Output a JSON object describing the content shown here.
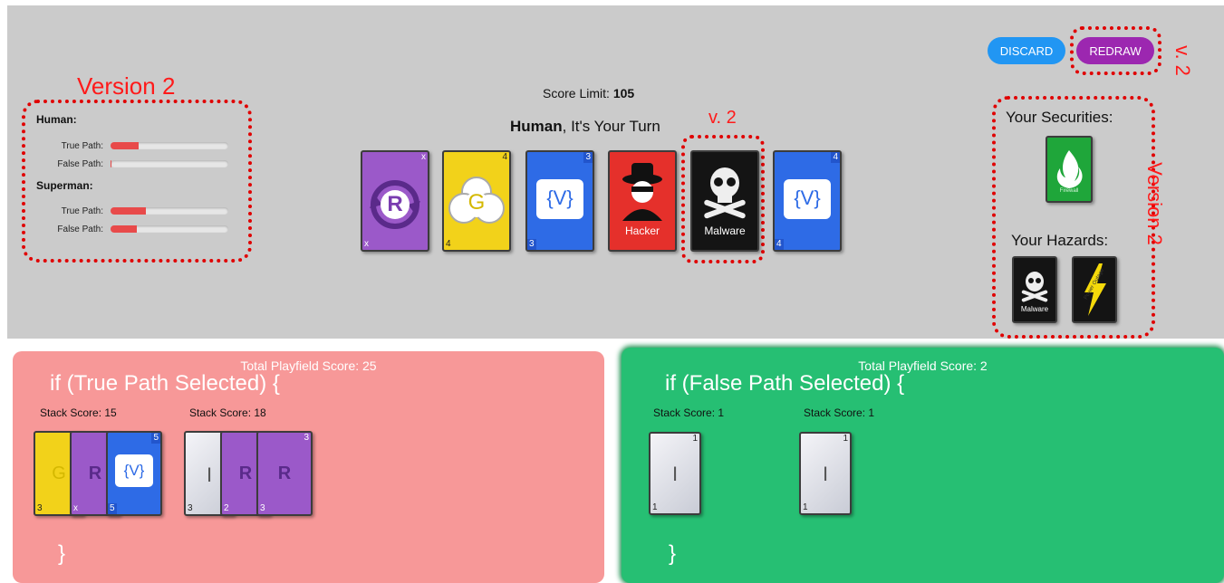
{
  "annotations": {
    "version2_players": "Version 2",
    "v2_redraw": "v. 2",
    "v2_malware": "v. 2",
    "version2_side": "Version 2"
  },
  "header": {
    "score_limit_label": "Score Limit:",
    "score_limit_value": "105",
    "turn_name": "Human",
    "turn_text": ", It's Your Turn"
  },
  "buttons": {
    "discard": "DISCARD",
    "redraw": "REDRAW"
  },
  "players": [
    {
      "name": "Human:",
      "true_label": "True Path:",
      "false_label": "False Path:",
      "true_pct": 24,
      "false_pct": 1
    },
    {
      "name": "Superman:",
      "true_label": "True Path:",
      "false_label": "False Path:",
      "true_pct": 30,
      "false_pct": 22
    }
  ],
  "hand": [
    {
      "type": "rotate",
      "color": "purple",
      "symbol": "R",
      "num": "x"
    },
    {
      "type": "gear",
      "color": "yellow",
      "symbol": "G",
      "num": "4"
    },
    {
      "type": "variable",
      "color": "blue",
      "symbol": "{V}",
      "num": "3"
    },
    {
      "type": "hacker",
      "color": "red",
      "symbol": "Hacker",
      "num": ""
    },
    {
      "type": "malware",
      "color": "black",
      "symbol": "Malware",
      "num": ""
    },
    {
      "type": "variable",
      "color": "blue",
      "symbol": "{V}",
      "num": "4"
    }
  ],
  "securities": {
    "label": "Your Securities:",
    "cards": [
      {
        "name": "Firewall"
      }
    ]
  },
  "hazards": {
    "label": "Your Hazards:",
    "cards": [
      {
        "name": "Malware"
      },
      {
        "name": "Power Outage"
      }
    ]
  },
  "true_field": {
    "total": "Total Playfield Score: 25",
    "condition": "if (True Path Selected) {",
    "close": "}",
    "stacks": [
      {
        "label": "Stack Score: 15",
        "cards": [
          {
            "color": "yellow",
            "symbol": "G",
            "num": "3"
          },
          {
            "color": "purple",
            "symbol": "R",
            "num": "x"
          },
          {
            "color": "blue",
            "symbol": "{V}",
            "num": "5"
          }
        ]
      },
      {
        "label": "Stack Score: 18",
        "cards": [
          {
            "color": "white",
            "symbol": "I",
            "num": "3"
          },
          {
            "color": "purple",
            "symbol": "R",
            "num": "2"
          },
          {
            "color": "purple",
            "symbol": "R",
            "num": "3"
          }
        ]
      }
    ]
  },
  "false_field": {
    "total": "Total Playfield Score: 2",
    "condition": "if (False Path Selected) {",
    "close": "}",
    "stacks": [
      {
        "label": "Stack Score: 1",
        "cards": [
          {
            "color": "white",
            "symbol": "I",
            "num": "1"
          }
        ]
      },
      {
        "label": "Stack Score: 1",
        "cards": [
          {
            "color": "white",
            "symbol": "I",
            "num": "1"
          }
        ]
      }
    ]
  }
}
